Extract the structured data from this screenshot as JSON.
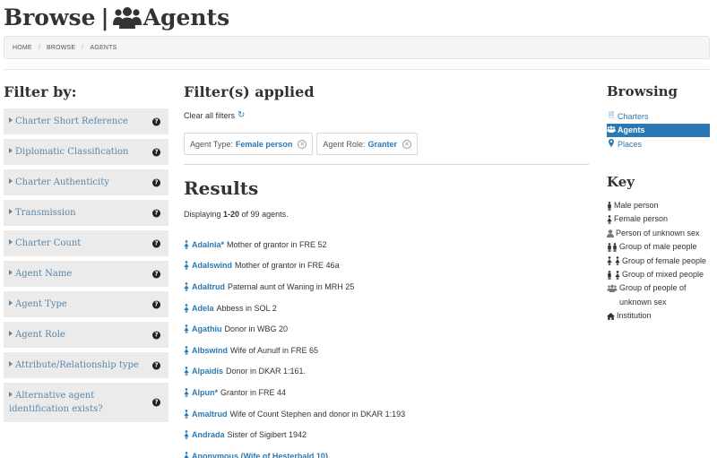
{
  "title": {
    "browse": "Browse",
    "separator": "|",
    "section": "Agents"
  },
  "breadcrumb": [
    "HOME",
    "BROWSE",
    "AGENTS"
  ],
  "filters": {
    "heading": "Filter by:",
    "items": [
      {
        "label": "Charter Short Reference"
      },
      {
        "label": "Diplomatic Classification"
      },
      {
        "label": "Charter Authenticity"
      },
      {
        "label": "Transmission"
      },
      {
        "label": "Charter Count"
      },
      {
        "label": "Agent Name"
      },
      {
        "label": "Agent Type"
      },
      {
        "label": "Agent Role"
      },
      {
        "label": "Attribute/Relationship type"
      },
      {
        "label": "Alternative agent identification exists?"
      }
    ],
    "help_glyph": "?"
  },
  "applied": {
    "heading": "Filter(s) applied",
    "clear_all": "Clear all filters",
    "chips": [
      {
        "field": "Agent Type:",
        "value": "Female person"
      },
      {
        "field": "Agent Role:",
        "value": "Granter"
      }
    ]
  },
  "results": {
    "heading": "Results",
    "displaying_prefix": "Displaying ",
    "displaying_range": "1-20",
    "displaying_suffix": " of 99 agents.",
    "items": [
      {
        "name": "Adalnia*",
        "desc": "Mother of grantor in FRE 52"
      },
      {
        "name": "Adalswind",
        "desc": "Mother of grantor in FRE 46a"
      },
      {
        "name": "Adaltrud",
        "desc": "Paternal aunt of Waning in MRH 25"
      },
      {
        "name": "Adela",
        "desc": "Abbess in SOL 2"
      },
      {
        "name": "Agathiu",
        "desc": "Donor in WBG 20"
      },
      {
        "name": "Albswind",
        "desc": "Wife of Aunulf in FRE 65"
      },
      {
        "name": "Alpaidis",
        "desc": "Donor in DKAR 1:161."
      },
      {
        "name": "Alpun*",
        "desc": "Grantor in FRE 44"
      },
      {
        "name": "Amaltrud",
        "desc": "Wife of Count Stephen and donor in DKAR 1:193"
      },
      {
        "name": "Andrada",
        "desc": "Sister of Sigibert 1942"
      },
      {
        "name": "Anonymous (Wife of Hesterbald 10)",
        "desc": ""
      }
    ]
  },
  "browsing": {
    "heading": "Browsing",
    "items": [
      {
        "label": "Charters",
        "icon": "file-icon",
        "active": false
      },
      {
        "label": "Agents",
        "icon": "users-icon",
        "active": true
      },
      {
        "label": "Places",
        "icon": "map-marker-icon",
        "active": false
      }
    ]
  },
  "key": {
    "heading": "Key",
    "items": [
      {
        "label": "Male person",
        "icon": "male-icon"
      },
      {
        "label": "Female person",
        "icon": "female-icon"
      },
      {
        "label": "Person of unknown sex",
        "icon": "user-icon"
      },
      {
        "label": "Group of male people",
        "icon": "male-group-icon"
      },
      {
        "label": "Group of female people",
        "icon": "female-group-icon"
      },
      {
        "label": "Group of mixed people",
        "icon": "mixed-group-icon"
      },
      {
        "label": "Group of people of unknown sex",
        "icon": "users-icon"
      },
      {
        "label": "Institution",
        "icon": "home-icon"
      }
    ]
  },
  "colors": {
    "link": "#2a79b5",
    "filter_text": "#5b86a8",
    "filter_bg": "#ebebeb",
    "active_bg": "#2a79b5"
  }
}
